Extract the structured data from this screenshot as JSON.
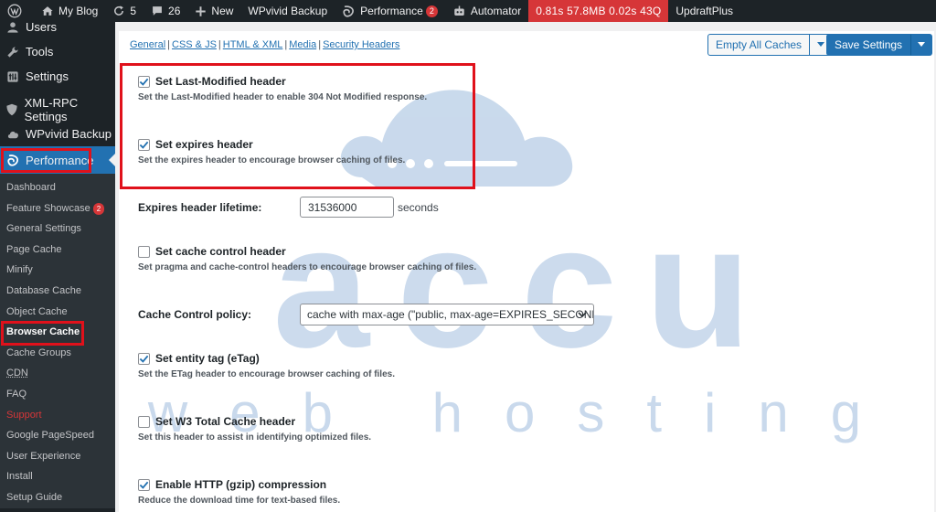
{
  "admin_bar": {
    "site_name": "My Blog",
    "updates_count": "5",
    "comments_count": "26",
    "new_label": "New",
    "wpvivid_label": "WPvivid Backup",
    "performance_label": "Performance",
    "performance_badge": "2",
    "automator_label": "Automator",
    "debug_info": "0.81s 57.8MB 0.02s 43Q",
    "updraft_label": "UpdraftPlus"
  },
  "sidebar": {
    "top_items": [
      {
        "label": "Users",
        "icon": "users-icon"
      },
      {
        "label": "Tools",
        "icon": "wrench-icon"
      },
      {
        "label": "Settings",
        "icon": "settings-icon"
      }
    ],
    "plugin_items": [
      {
        "label": "XML-RPC Settings",
        "icon": "shield-icon"
      },
      {
        "label": "WPvivid Backup",
        "icon": "cloud-icon"
      }
    ],
    "active_item": {
      "label": "Performance",
      "icon": "w3tc-icon"
    },
    "submenu": [
      {
        "label": "Dashboard"
      },
      {
        "label": "Feature Showcase",
        "badge": "2"
      },
      {
        "label": "General Settings"
      },
      {
        "label": "Page Cache"
      },
      {
        "label": "Minify"
      },
      {
        "label": "Database Cache"
      },
      {
        "label": "Object Cache"
      },
      {
        "label": "Browser Cache",
        "current": true
      },
      {
        "label": "Cache Groups"
      },
      {
        "label": "CDN"
      },
      {
        "label": "FAQ"
      },
      {
        "label": "Support",
        "color": "red"
      },
      {
        "label": "Google PageSpeed"
      },
      {
        "label": "User Experience"
      },
      {
        "label": "Install"
      },
      {
        "label": "Setup Guide"
      }
    ]
  },
  "tabs": [
    "General",
    "CSS & JS",
    "HTML & XML",
    "Media",
    "Security Headers"
  ],
  "toolbar": {
    "empty_caches_label": "Empty All Caches",
    "save_settings_label": "Save Settings"
  },
  "watermark": {
    "brand": "accu",
    "tagline": "web hosting"
  },
  "options": {
    "last_modified": {
      "label": "Set Last-Modified header",
      "desc": "Set the Last-Modified header to enable 304 Not Modified response.",
      "checked": true
    },
    "expires_header": {
      "label": "Set expires header",
      "desc": "Set the expires header to encourage browser caching of files.",
      "checked": true
    },
    "expires_lifetime": {
      "label": "Expires header lifetime:",
      "value": "31536000",
      "unit": "seconds"
    },
    "cache_control": {
      "label": "Set cache control header",
      "desc": "Set pragma and cache-control headers to encourage browser caching of files.",
      "checked": false
    },
    "cache_control_policy": {
      "label": "Cache Control policy:",
      "value": "cache with max-age (\"public, max-age=EXPIRES_SECONDS\")"
    },
    "etag": {
      "label": "Set entity tag (eTag)",
      "desc": "Set the ETag header to encourage browser caching of files.",
      "checked": true
    },
    "w3tc_header": {
      "label": "Set W3 Total Cache header",
      "desc": "Set this header to assist in identifying optimized files.",
      "checked": false
    },
    "gzip": {
      "label": "Enable HTTP (gzip) compression",
      "desc": "Reduce the download time for text-based files.",
      "checked": true
    }
  },
  "colors": {
    "admin_bar": "#1d2327",
    "accent": "#2271b1",
    "highlight_box": "#e0111b",
    "badge": "#d63638",
    "watermark": "#b7cde6"
  }
}
